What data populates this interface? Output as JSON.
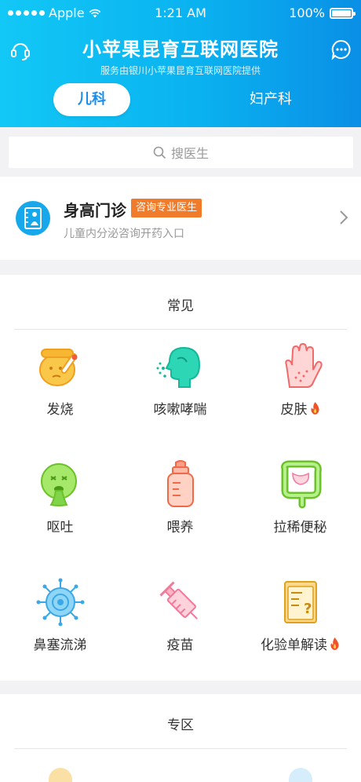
{
  "status_bar": {
    "carrier": "Apple",
    "time": "1:21 AM",
    "battery": "100%"
  },
  "header": {
    "title": "小苹果昆育互联网医院",
    "subtitle": "服务由银川小苹果昆育互联网医院提供",
    "left_icon": "headset-icon",
    "right_icon": "chat-icon"
  },
  "tabs": [
    {
      "label": "儿科",
      "active": true
    },
    {
      "label": "妇产科",
      "active": false
    }
  ],
  "search": {
    "placeholder": "搜医生"
  },
  "clinic": {
    "title": "身高门诊",
    "badge": "咨询专业医生",
    "subtitle": "儿童内分泌咨询开药入口",
    "icon": "height-chart-icon"
  },
  "common": {
    "title": "常见",
    "items": [
      {
        "label": "发烧",
        "icon": "fever-icon",
        "hot": false
      },
      {
        "label": "咳嗽哮喘",
        "icon": "cough-icon",
        "hot": false
      },
      {
        "label": "皮肤",
        "icon": "skin-hand-icon",
        "hot": true
      },
      {
        "label": "呕吐",
        "icon": "vomit-icon",
        "hot": false
      },
      {
        "label": "喂养",
        "icon": "bottle-icon",
        "hot": false
      },
      {
        "label": "拉稀便秘",
        "icon": "intestine-icon",
        "hot": false
      },
      {
        "label": "鼻塞流涕",
        "icon": "virus-icon",
        "hot": false
      },
      {
        "label": "疫苗",
        "icon": "syringe-icon",
        "hot": false
      },
      {
        "label": "化验单解读",
        "icon": "lab-report-icon",
        "hot": true
      }
    ]
  },
  "zone": {
    "title": "专区"
  },
  "colors": {
    "header_start": "#12c8f6",
    "header_end": "#0a8fe6",
    "badge": "#f07b2a",
    "tab_active_text": "#1a8de9",
    "hot": "#f0522a"
  }
}
